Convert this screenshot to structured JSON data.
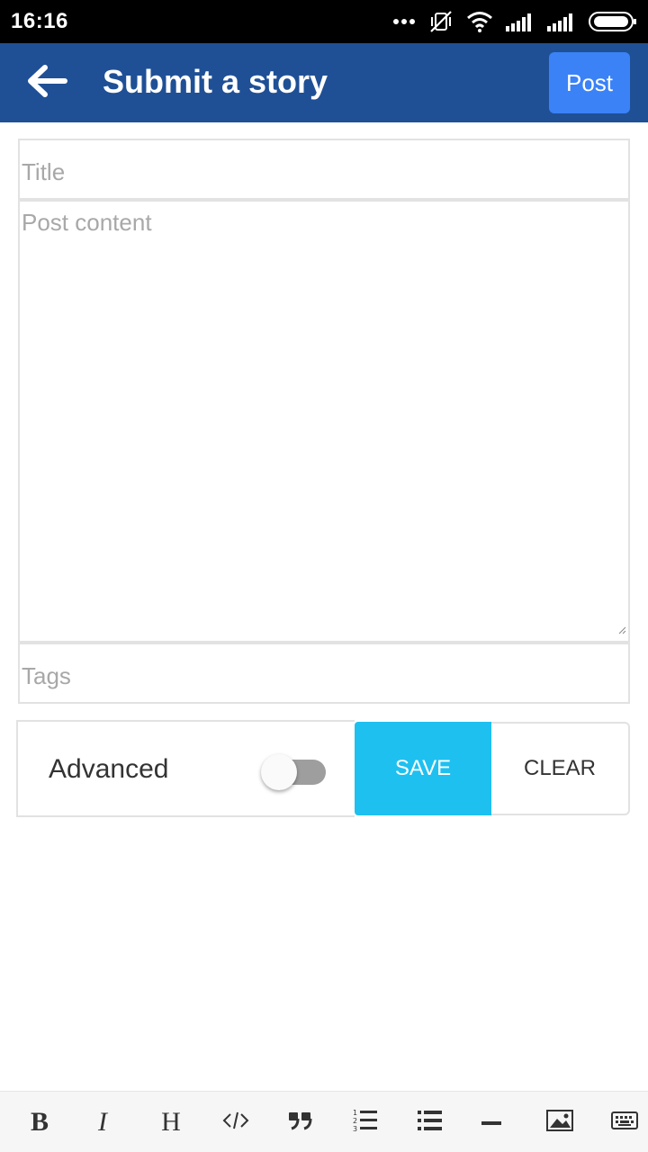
{
  "status_bar": {
    "time": "16:16",
    "icons": [
      "more-dots-icon",
      "vibrate-off-icon",
      "wifi-icon",
      "signal-icon",
      "signal-icon",
      "battery-icon"
    ]
  },
  "app_bar": {
    "back_icon": "arrow-left-icon",
    "title": "Submit a story",
    "post_label": "Post",
    "color": "#1f5096",
    "post_color": "#3b82f6"
  },
  "form": {
    "title_placeholder": "Title",
    "content_placeholder": "Post content",
    "tags_placeholder": "Tags"
  },
  "controls": {
    "advanced_label": "Advanced",
    "advanced_on": false,
    "save_label": "SAVE",
    "clear_label": "CLEAR",
    "save_color": "#1ec0f0"
  },
  "toolbar": {
    "bold_label": "B",
    "italic_label": "I",
    "heading_label": "H",
    "icons": [
      "bold-icon",
      "italic-icon",
      "heading-icon",
      "code-icon",
      "quote-icon",
      "ordered-list-icon",
      "unordered-list-icon",
      "horizontal-rule-icon",
      "image-icon",
      "keyboard-icon"
    ]
  }
}
